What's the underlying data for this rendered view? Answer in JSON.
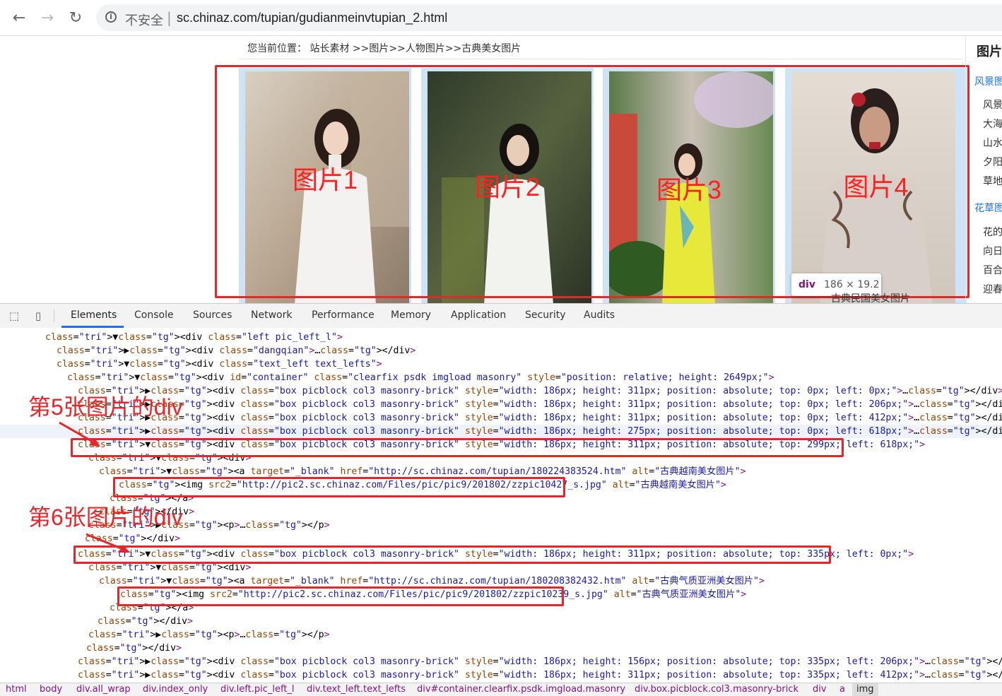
{
  "browser": {
    "back_icon": "←",
    "forward_icon": "→",
    "reload_icon": "↻",
    "security_label": "不安全",
    "url": "sc.chinaz.com/tupian/gudianmeinvtupian_2.html"
  },
  "page": {
    "breadcrumb": "您当前位置： 站长素材 >>图片>>人物图片>>古典美女图片",
    "pictures": [
      {
        "label": "图片1"
      },
      {
        "label": "图片2"
      },
      {
        "label": "图片3"
      },
      {
        "label": "图片4"
      }
    ],
    "sidebar": {
      "title": "图片",
      "categories": [
        {
          "label": "风景图",
          "items": [
            "风景",
            "大海",
            "山水",
            "夕阳",
            "草地"
          ]
        },
        {
          "label": "花草图",
          "items": [
            "花的",
            "向日",
            "百合",
            "迎春"
          ]
        }
      ]
    },
    "tooltip": {
      "tag": "div",
      "dims": "186 × 19.2"
    },
    "caption": "古典民国美女图片"
  },
  "devtools": {
    "tabs": [
      "Elements",
      "Console",
      "Sources",
      "Network",
      "Performance",
      "Memory",
      "Application",
      "Security",
      "Audits"
    ],
    "annotations": {
      "div5": "第5张图片的div",
      "div6": "第6张图片的div"
    },
    "lines": [
      "▼<div class=\"left pic_left_l\">",
      "▶<div class=\"dangqian\">…</div>",
      "▼<div class=\"text_left text_lefts\">",
      "▼<div id=\"container\" class=\"clearfix psdk imgload masonry\" style=\"position: relative; height: 2649px;\">",
      "▶<div class=\"box picblock col3 masonry-brick\" style=\"width: 186px; height: 311px; position: absolute; top: 0px; left: 0px;\">…</div>",
      "▶<div class=\"box picblock col3 masonry-brick\" style=\"width: 186px; height: 311px; position: absolute; top: 0px; left: 206px;\">…</div>",
      "▶<div class=\"box picblock col3 masonry-brick\" style=\"width: 186px; height: 311px; position: absolute; top: 0px; left: 412px;\">…</div>",
      "▶<div class=\"box picblock col3 masonry-brick\" style=\"width: 186px; height: 275px; position: absolute; top: 0px; left: 618px;\">…</div>",
      "▼<div class=\"box picblock col3 masonry-brick\" style=\"width: 186px; height: 311px; position: absolute; top: 299px; left: 618px;\">",
      "▼<div>",
      "▼<a target=\"_blank\" href=\"http://sc.chinaz.com/tupian/180224383524.htm\" alt=\"古典越南美女图片\">",
      "<img src2=\"http://pic2.sc.chinaz.com/Files/pic/pic9/201802/zzpic10427_s.jpg\" alt=\"古典越南美女图片\">",
      "</a>",
      "</div>",
      "▶<p>…</p>",
      "</div>",
      "▼<div class=\"box picblock col3 masonry-brick\" style=\"width: 186px; height: 311px; position: absolute; top: 335px; left: 0px;\">",
      "▼<div>",
      "▼<a target=\"_blank\" href=\"http://sc.chinaz.com/tupian/180208382432.htm\" alt=\"古典气质亚洲美女图片\">",
      "<img src2=\"http://pic2.sc.chinaz.com/Files/pic/pic9/201802/zzpic10239_s.jpg\" alt=\"古典气质亚洲美女图片\">",
      "</a>",
      "</div>",
      "▶<p>…</p>",
      "</div>",
      "▶<div class=\"box picblock col3 masonry-brick\" style=\"width: 186px; height: 156px; position: absolute; top: 335px; left: 206px;\">…</div>",
      "▶<div class=\"box picblock col3 masonry-brick\" style=\"width: 186px; height: 311px; position: absolute; top: 335px; left: 412px;\">…</div>"
    ],
    "breadcrumbs": [
      "html",
      "body",
      "div.all_wrap",
      "div.index_only",
      "div.left.pic_left_l",
      "div.text_left.text_lefts",
      "div#container.clearfix.psdk.imgload.masonry",
      "div.box.picblock.col3.masonry-brick",
      "div",
      "a",
      "img"
    ]
  }
}
